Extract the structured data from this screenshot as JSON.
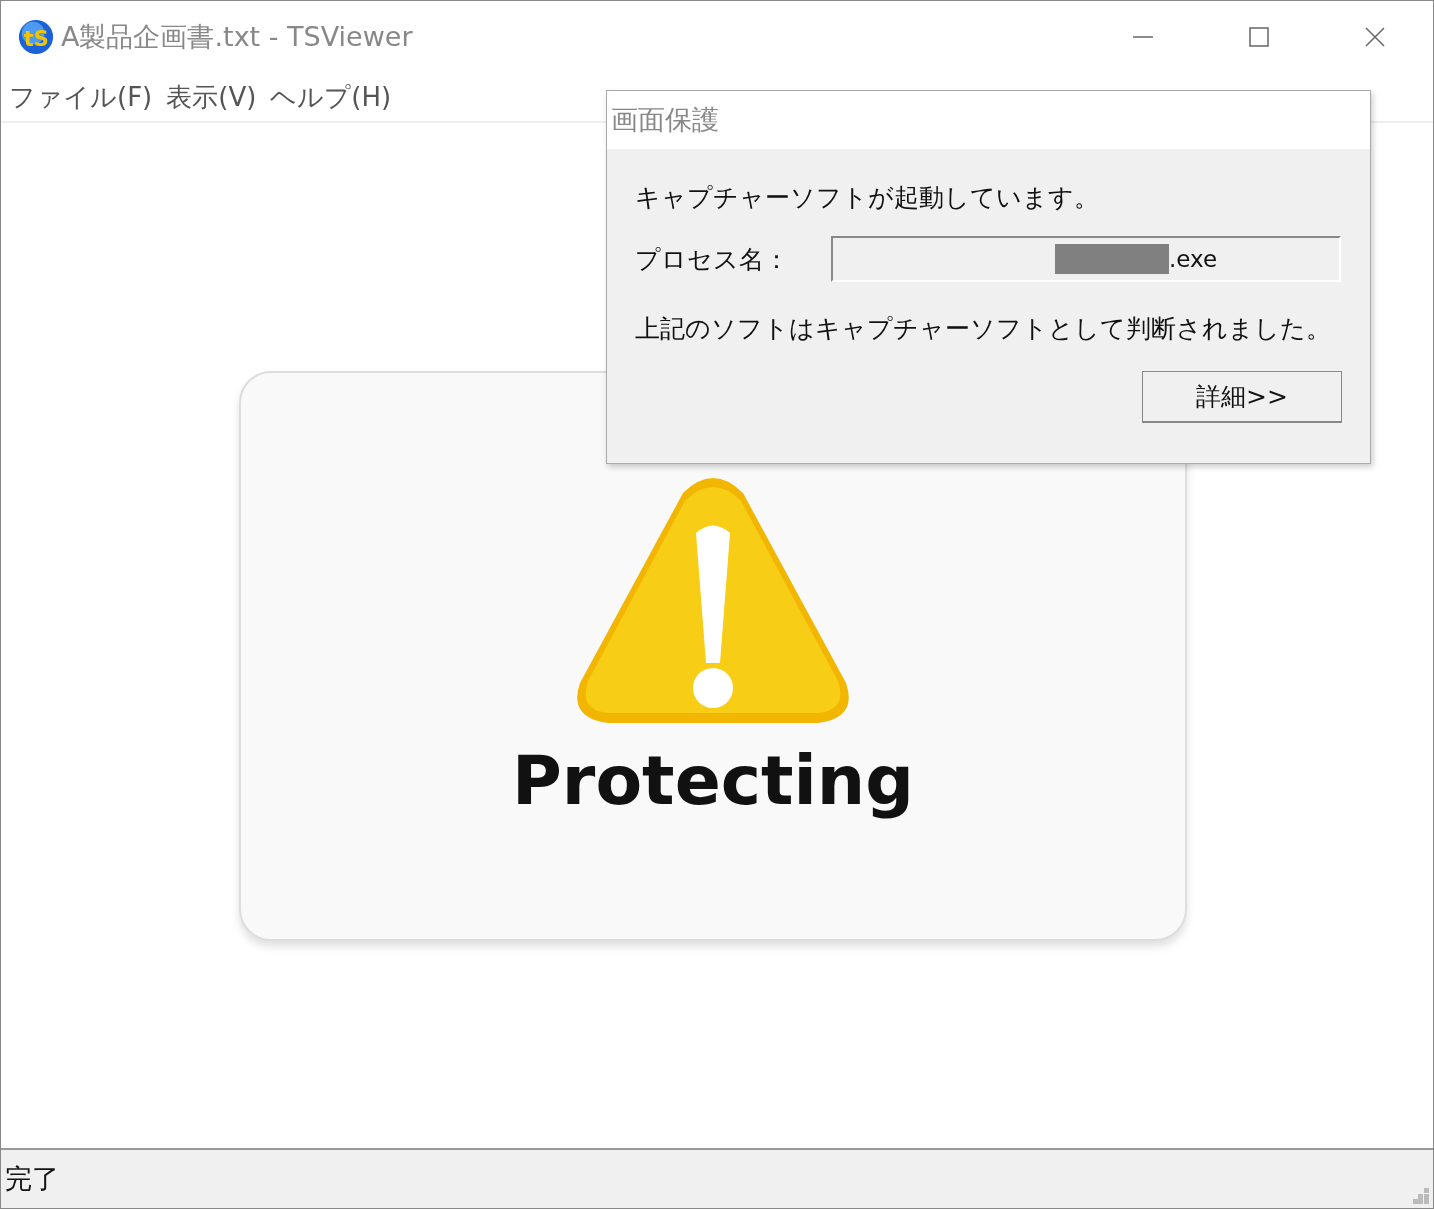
{
  "window": {
    "title": "A製品企画書.txt - TSViewer",
    "logo_text": "tS"
  },
  "menu": [
    "ファイル(F)",
    "表示(V)",
    "ヘルプ(H)"
  ],
  "content": {
    "banner": "Protecting"
  },
  "dialog": {
    "title": "画面保護",
    "message": "キャプチャーソフトが起動しています。",
    "process_label": "プロセス名：",
    "process_value": ".exe",
    "redacted": true,
    "note": "上記のソフトはキャプチャーソフトとして判断されました。",
    "button": "詳細>>"
  },
  "status_bar": {
    "text": "完了"
  }
}
